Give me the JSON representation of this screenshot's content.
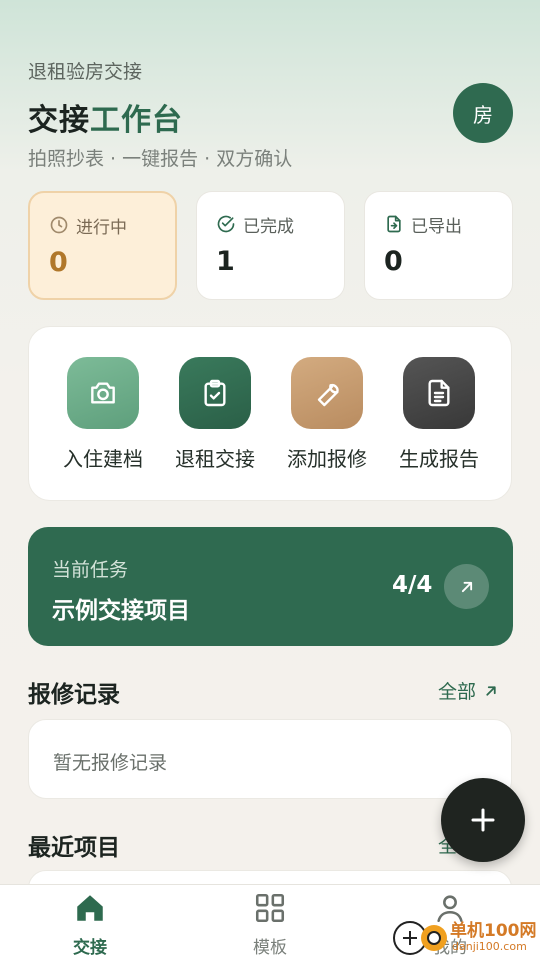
{
  "header": {
    "eyebrow": "退租验房交接",
    "title_main": "交接",
    "title_accent": "工作台",
    "subtitle": "拍照抄表 · 一键报告 · 双方确认",
    "avatar": "房"
  },
  "stats": [
    {
      "label": "进行中",
      "value": "0",
      "icon": "clock-icon"
    },
    {
      "label": "已完成",
      "value": "1",
      "icon": "check-circle-icon"
    },
    {
      "label": "已导出",
      "value": "0",
      "icon": "file-export-icon"
    }
  ],
  "actions": [
    {
      "label": "入住建档",
      "icon": "camera-icon",
      "color": "#6fae8b"
    },
    {
      "label": "退租交接",
      "icon": "clipboard-check-icon",
      "color": "#2f6a50"
    },
    {
      "label": "添加报修",
      "icon": "wrench-icon",
      "color": "#c49a6e"
    },
    {
      "label": "生成报告",
      "icon": "document-icon",
      "color": "#454545"
    }
  ],
  "task": {
    "caption": "当前任务",
    "name": "示例交接项目",
    "progress": "4/4"
  },
  "repairs": {
    "title": "报修记录",
    "link": "全部",
    "empty": "暂无报修记录"
  },
  "recent": {
    "title": "最近项目",
    "link": "全"
  },
  "nav": [
    {
      "label": "交接",
      "icon": "home-icon",
      "active": true
    },
    {
      "label": "模板",
      "icon": "grid-icon",
      "active": false
    },
    {
      "label": "我的",
      "icon": "user-icon",
      "active": false
    }
  ],
  "watermark": {
    "text": "单机100网",
    "url": "danji100.com"
  },
  "colors": {
    "primary": "#2f6a50",
    "accent_orange": "#b0772a",
    "fab": "#1f2420"
  }
}
